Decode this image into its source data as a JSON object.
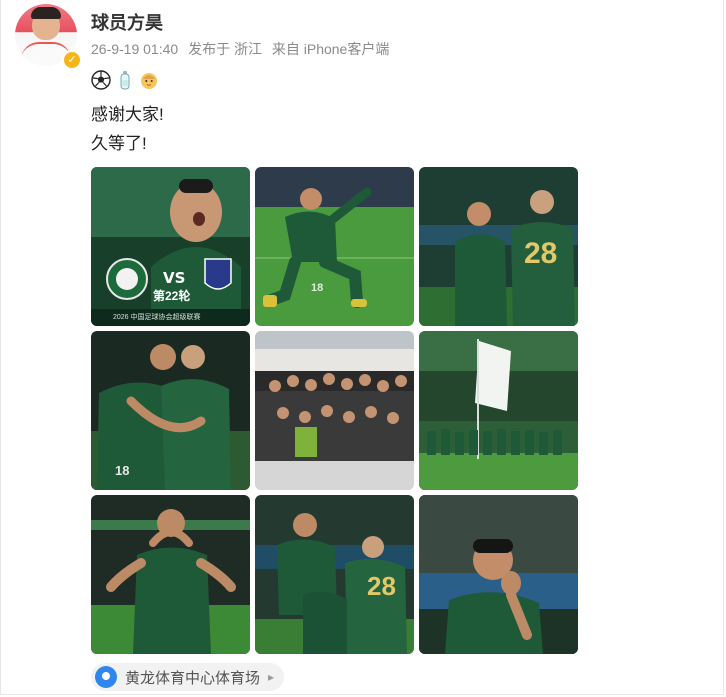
{
  "post": {
    "author": "球员方昊",
    "date": "26-9-19 01:40",
    "published_in": "发布于 浙江",
    "source": "来自 iPhone客户端",
    "emojis": [
      "soccer-ball-icon",
      "bottle-icon",
      "baby-icon"
    ],
    "lines": [
      "感谢大家!",
      "久等了!"
    ],
    "location": "黄龙体育中心体育场"
  },
  "photos": [
    {
      "caption": "VS",
      "round": "第22轮",
      "footer": "2026 中国足球协会超级联赛"
    },
    {
      "caption": "18"
    },
    {
      "caption": "28"
    },
    {
      "caption": "18"
    },
    {
      "caption": ""
    },
    {
      "caption": ""
    },
    {
      "caption": ""
    },
    {
      "caption": "28"
    },
    {
      "caption": ""
    }
  ],
  "colors": {
    "accent": "#2f86ee",
    "team_green": "#1f5a36",
    "pitch": "#3f9a3c",
    "vip": "#f8b51a"
  }
}
